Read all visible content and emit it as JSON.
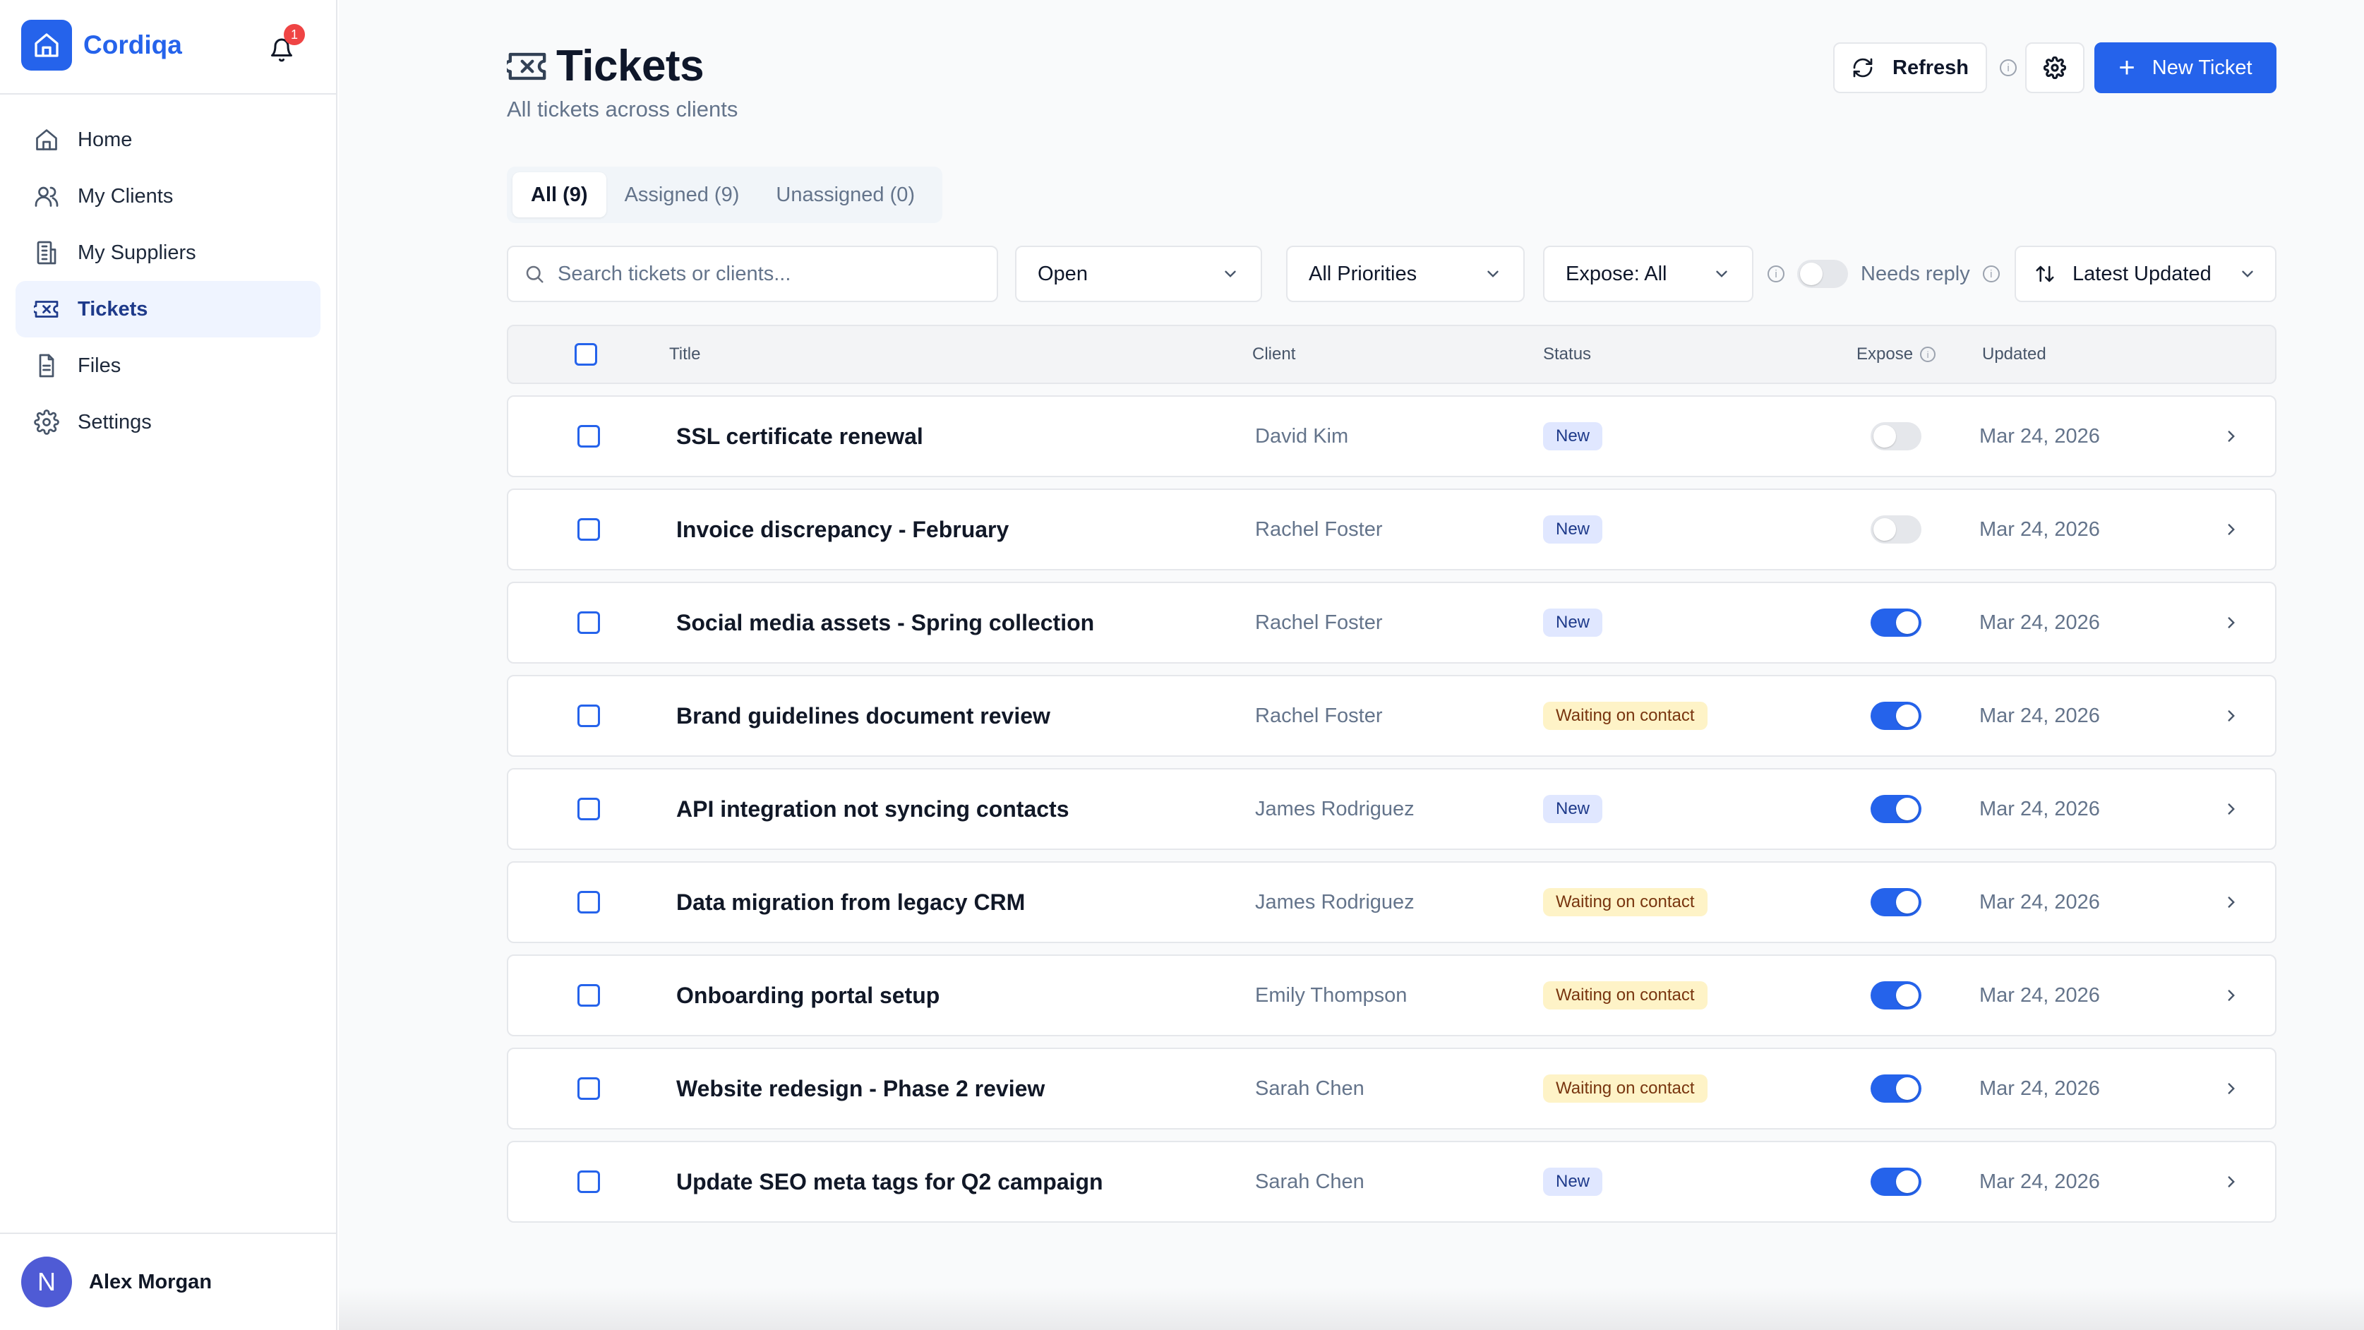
{
  "brand": {
    "name": "Cordiqa",
    "notification_count": "1"
  },
  "nav": [
    {
      "label": "Home",
      "icon": "home-icon",
      "active": false
    },
    {
      "label": "My Clients",
      "icon": "users-icon",
      "active": false
    },
    {
      "label": "My Suppliers",
      "icon": "building-icon",
      "active": false
    },
    {
      "label": "Tickets",
      "icon": "ticket-icon",
      "active": true
    },
    {
      "label": "Files",
      "icon": "file-icon",
      "active": false
    },
    {
      "label": "Settings",
      "icon": "gear-icon",
      "active": false
    }
  ],
  "user": {
    "initial": "N",
    "name": "Alex Morgan"
  },
  "page": {
    "title": "Tickets",
    "subtitle": "All tickets across clients"
  },
  "actions": {
    "refresh_label": "Refresh",
    "new_ticket_label": "New Ticket"
  },
  "tabs": [
    {
      "label": "All (9)",
      "active": true
    },
    {
      "label": "Assigned (9)",
      "active": false
    },
    {
      "label": "Unassigned (0)",
      "active": false
    }
  ],
  "filters": {
    "search_placeholder": "Search tickets or clients...",
    "status": "Open",
    "priority": "All Priorities",
    "expose": "Expose: All",
    "needs_reply_label": "Needs reply",
    "needs_reply_on": false,
    "sort": "Latest Updated"
  },
  "table": {
    "headers": {
      "title": "Title",
      "client": "Client",
      "status": "Status",
      "expose": "Expose",
      "updated": "Updated"
    },
    "rows": [
      {
        "title": "SSL certificate renewal",
        "client": "David Kim",
        "status": "New",
        "status_kind": "new",
        "expose": false,
        "updated": "Mar 24, 2026"
      },
      {
        "title": "Invoice discrepancy - February",
        "client": "Rachel Foster",
        "status": "New",
        "status_kind": "new",
        "expose": false,
        "updated": "Mar 24, 2026"
      },
      {
        "title": "Social media assets - Spring collection",
        "client": "Rachel Foster",
        "status": "New",
        "status_kind": "new",
        "expose": true,
        "updated": "Mar 24, 2026"
      },
      {
        "title": "Brand guidelines document review",
        "client": "Rachel Foster",
        "status": "Waiting on contact",
        "status_kind": "waiting",
        "expose": true,
        "updated": "Mar 24, 2026"
      },
      {
        "title": "API integration not syncing contacts",
        "client": "James Rodriguez",
        "status": "New",
        "status_kind": "new",
        "expose": true,
        "updated": "Mar 24, 2026"
      },
      {
        "title": "Data migration from legacy CRM",
        "client": "James Rodriguez",
        "status": "Waiting on contact",
        "status_kind": "waiting",
        "expose": true,
        "updated": "Mar 24, 2026"
      },
      {
        "title": "Onboarding portal setup",
        "client": "Emily Thompson",
        "status": "Waiting on contact",
        "status_kind": "waiting",
        "expose": true,
        "updated": "Mar 24, 2026"
      },
      {
        "title": "Website redesign - Phase 2 review",
        "client": "Sarah Chen",
        "status": "Waiting on contact",
        "status_kind": "waiting",
        "expose": true,
        "updated": "Mar 24, 2026"
      },
      {
        "title": "Update SEO meta tags for Q2 campaign",
        "client": "Sarah Chen",
        "status": "New",
        "status_kind": "new",
        "expose": true,
        "updated": "Mar 24, 2026"
      }
    ]
  },
  "colors": {
    "accent": "#2563eb",
    "badge_new_bg": "#e0e7ff",
    "badge_waiting_bg": "#fef3c7",
    "notification": "#ef4444"
  }
}
